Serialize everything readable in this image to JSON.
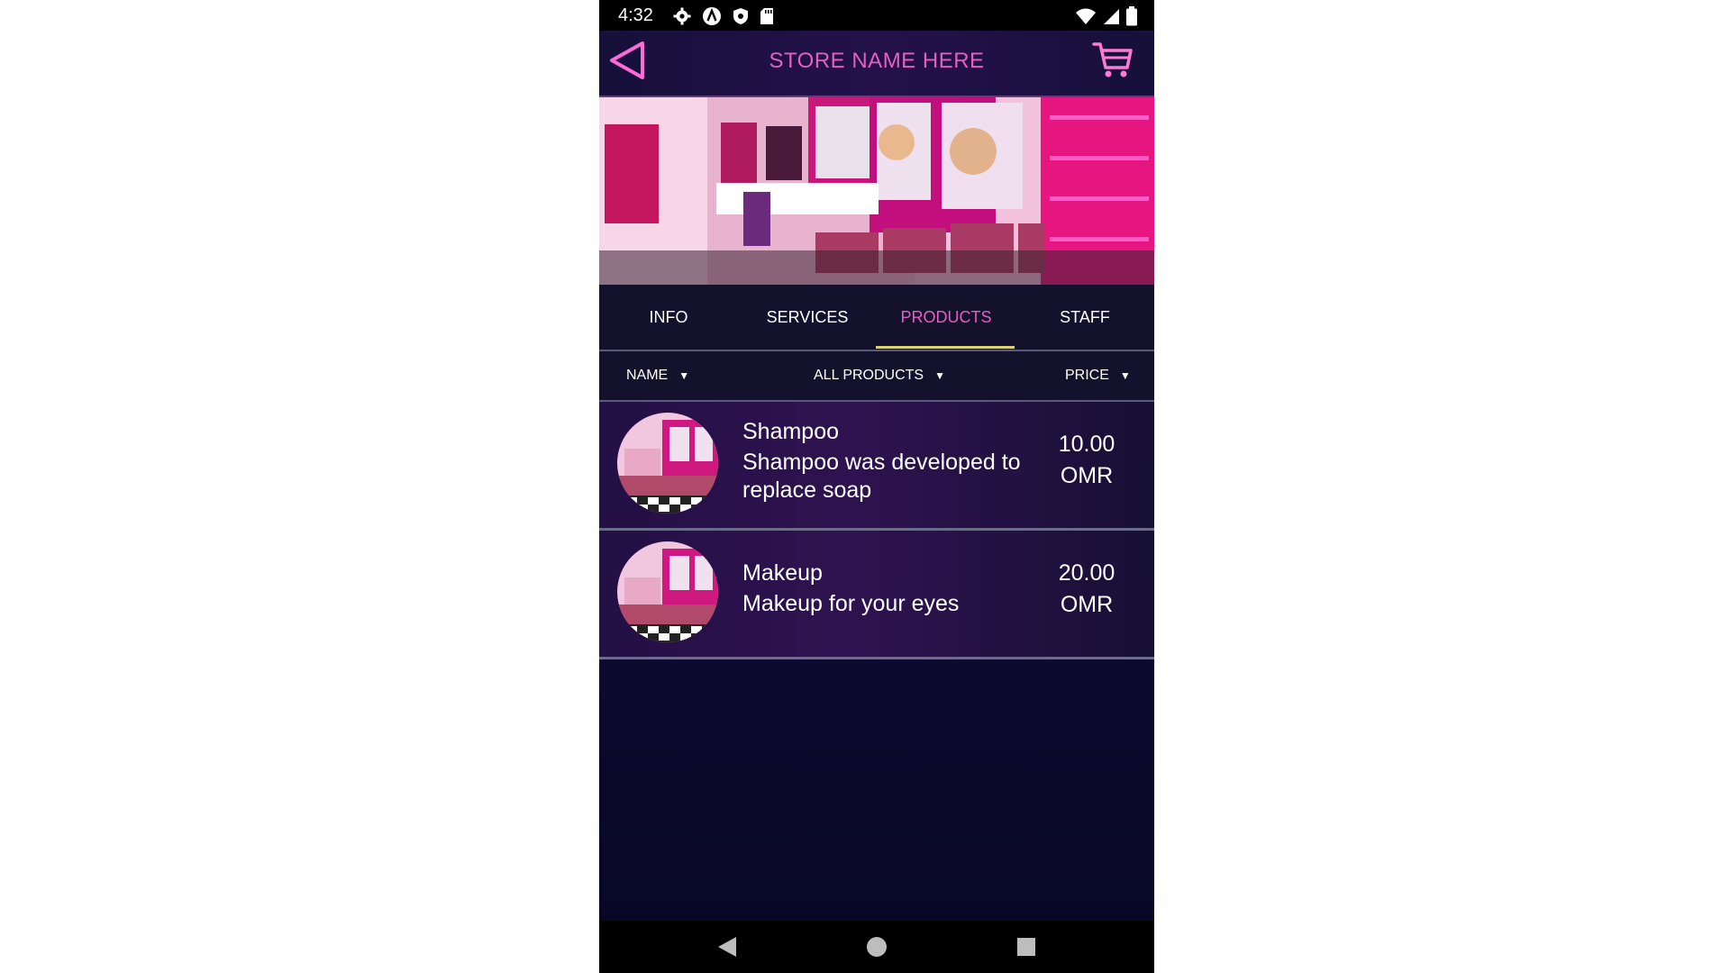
{
  "status_bar": {
    "time": "4:32",
    "icons": [
      "settings-icon",
      "a-icon",
      "shield-icon",
      "sd-card-icon",
      "wifi-icon",
      "signal-icon",
      "battery-icon"
    ]
  },
  "app_bar": {
    "title": "STORE NAME HERE",
    "back_icon": "back-triangle-icon",
    "cart_icon": "cart-icon",
    "accent_color": "#e35fc0"
  },
  "banner": {
    "description": ""
  },
  "tabs": [
    {
      "label": "INFO",
      "active": false
    },
    {
      "label": "SERVICES",
      "active": false
    },
    {
      "label": "PRODUCTS",
      "active": true
    },
    {
      "label": "STAFF",
      "active": false
    }
  ],
  "filters": {
    "name": "NAME",
    "category": "ALL PRODUCTS",
    "price": "PRICE"
  },
  "products": [
    {
      "name": "Shampoo",
      "description": "Shampoo was developed to replace soap",
      "price": "10.00",
      "currency": "OMR"
    },
    {
      "name": "Makeup",
      "description": "Makeup for your eyes",
      "price": "20.00",
      "currency": "OMR"
    }
  ],
  "nav_bar": {
    "back": "nav-back-icon",
    "home": "nav-home-icon",
    "recents": "nav-recents-icon"
  }
}
